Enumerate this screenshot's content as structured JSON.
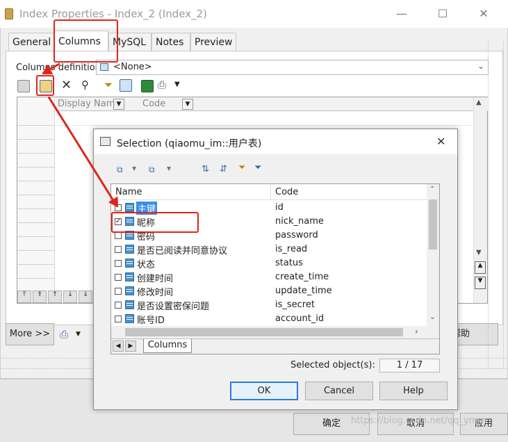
{
  "window": {
    "title": "Index Properties - Index_2 (Index_2)",
    "tabs": [
      "General",
      "Columns",
      "MySQL",
      "Notes",
      "Preview"
    ],
    "active_tab": "Columns",
    "columns_definition_label": "Columns definition:",
    "columns_definition_value": "<None>",
    "grid_headers": [
      "Display Nam",
      "Code"
    ],
    "more_button": "More >>",
    "help_button_partial": "帮助"
  },
  "footer": {
    "ok_button": "确定",
    "cancel_button": "取消",
    "apply_button_partial": "应用"
  },
  "dialog": {
    "title": "Selection (qiaomu_im::用户表)",
    "columns": [
      "Name",
      "Code"
    ],
    "rows": [
      {
        "name": "主键",
        "code": "id",
        "checked": false,
        "highlighted": true
      },
      {
        "name": "昵称",
        "code": "nick_name",
        "checked": true,
        "highlighted": false
      },
      {
        "name": "密码",
        "code": "password",
        "checked": false,
        "highlighted": false
      },
      {
        "name": "是否已阅读并同意协议",
        "code": "is_read",
        "checked": false,
        "highlighted": false
      },
      {
        "name": "状态",
        "code": "status",
        "checked": false,
        "highlighted": false
      },
      {
        "name": "创建时间",
        "code": "create_time",
        "checked": false,
        "highlighted": false
      },
      {
        "name": "修改时间",
        "code": "update_time",
        "checked": false,
        "highlighted": false
      },
      {
        "name": "是否设置密保问题",
        "code": "is_secret",
        "checked": false,
        "highlighted": false
      },
      {
        "name": "账号ID",
        "code": "account_id",
        "checked": false,
        "highlighted": false
      }
    ],
    "sheet_tab": "Columns",
    "selected_label": "Selected object(s):",
    "selected_value": "1 / 17",
    "ok_button": "OK",
    "cancel_button": "Cancel",
    "help_button": "Help"
  },
  "watermark": "https://blog.csdn.net/qq_ymm",
  "colors": {
    "annotation_red": "#e0241a",
    "selection_blue": "#3a8ee6"
  }
}
